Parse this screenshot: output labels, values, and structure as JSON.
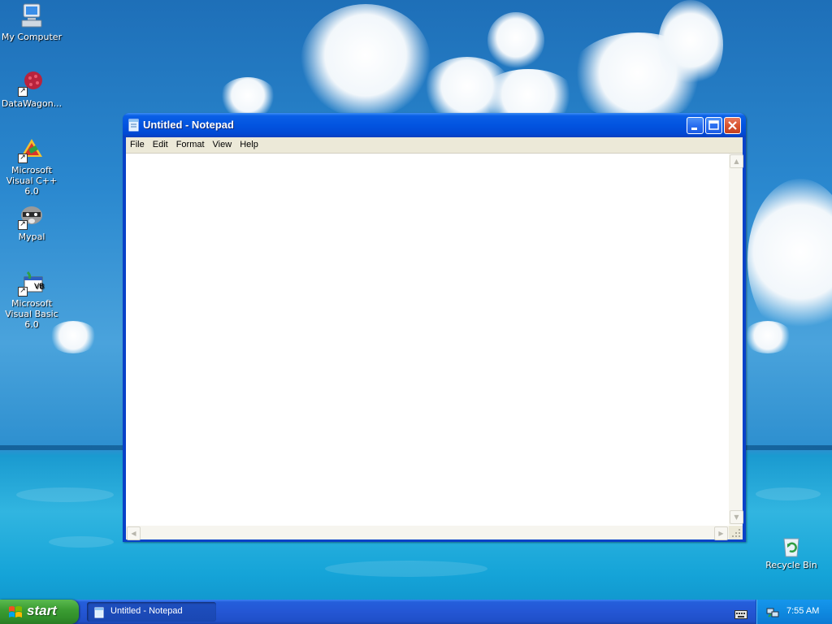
{
  "desktop": {
    "icons": [
      {
        "label": "My Computer"
      },
      {
        "label": "DataWagon..."
      },
      {
        "label": "Microsoft Visual C++ 6.0"
      },
      {
        "label": "Mypal"
      },
      {
        "label": "Microsoft Visual Basic 6.0"
      },
      {
        "label": "Recycle Bin"
      }
    ]
  },
  "notepad": {
    "title": "Untitled - Notepad",
    "menu": [
      "File",
      "Edit",
      "Format",
      "View",
      "Help"
    ],
    "content": ""
  },
  "taskbar": {
    "start_label": "start",
    "tasks": [
      {
        "label": "Untitled - Notepad"
      }
    ],
    "clock": "7:55 AM"
  },
  "colors": {
    "title_bar": "#0254e0",
    "start_button": "#3c9d33",
    "taskbar": "#245edb",
    "close_button": "#d9552f"
  }
}
